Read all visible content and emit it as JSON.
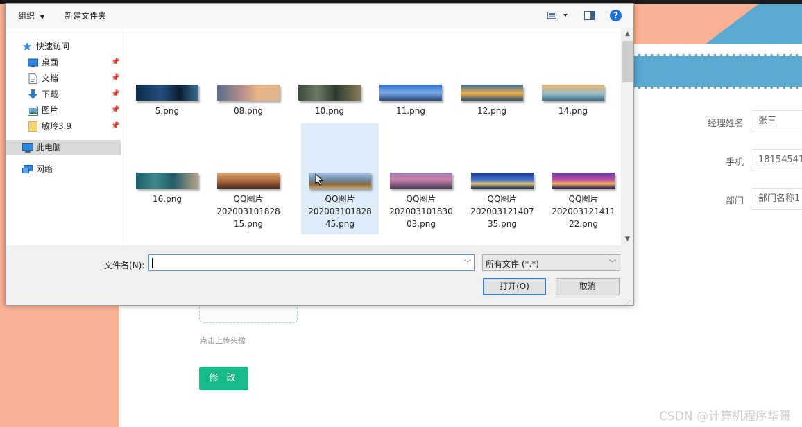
{
  "background_page": {
    "labels": {
      "manager_name": "经理姓名",
      "phone": "手机",
      "department": "部门"
    },
    "values": {
      "manager_name": "张三",
      "phone": "18154541",
      "department_placeholder": "部门名称1"
    },
    "upload_hint": "点击上传头像",
    "modify_button": "修 改",
    "watermark": "CSDN @计算机程序华哥",
    "colors": {
      "salmon": "#fbb194",
      "blue": "#5aa9d0",
      "green": "#17bb8b"
    }
  },
  "dialog": {
    "toolbar": {
      "organize": "组织",
      "new_folder": "新建文件夹",
      "view_icon": "view-options-icon",
      "pane_icon": "preview-pane-icon",
      "help_icon": "help-icon",
      "help_glyph": "?"
    },
    "nav": {
      "quick_access": "快速访问",
      "items": [
        {
          "label": "桌面",
          "icon": "desktop-icon",
          "pinned": true
        },
        {
          "label": "文档",
          "icon": "document-icon",
          "pinned": true
        },
        {
          "label": "下载",
          "icon": "download-icon",
          "pinned": true
        },
        {
          "label": "图片",
          "icon": "pictures-icon",
          "pinned": true
        },
        {
          "label": "敏玲3.9",
          "icon": "folder-icon",
          "pinned": true
        }
      ],
      "this_pc": "此电脑",
      "network": "网络"
    },
    "files_row1": [
      "5.png",
      "08.png",
      "10.png",
      "11.png",
      "12.png",
      "14.png"
    ],
    "files_row2": [
      "16.png",
      "QQ图片\n20200310182815.png",
      "QQ图片\n20200310182845.png",
      "QQ图片\n20200310183003.png",
      "QQ图片\n20200312140735.png",
      "QQ图片\n20200312141122.png"
    ],
    "files_row2_lines": [
      [
        "16.png"
      ],
      [
        "QQ图片",
        "202003101828",
        "15.png"
      ],
      [
        "QQ图片",
        "202003101828",
        "45.png"
      ],
      [
        "QQ图片",
        "202003101830",
        "03.png"
      ],
      [
        "QQ图片",
        "202003121407",
        "35.png"
      ],
      [
        "QQ图片",
        "202003121411",
        "22.png"
      ]
    ],
    "selected_file": "QQ图片20200310182845.png",
    "filename_label": "文件名(N):",
    "filename_value": "",
    "filetype_value": "所有文件 (*.*)",
    "open_button": "打开(O)",
    "cancel_button": "取消"
  }
}
